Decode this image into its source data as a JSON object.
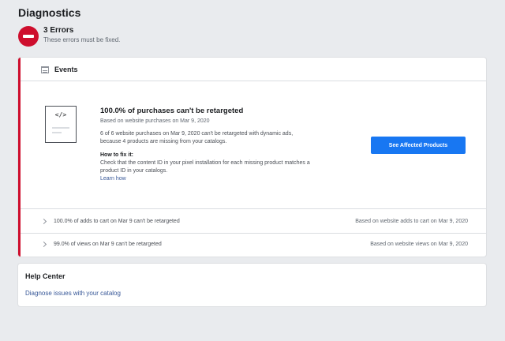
{
  "page": {
    "title": "Diagnostics"
  },
  "error_summary": {
    "count_label": "3 Errors",
    "subtitle": "These errors must be fixed.",
    "icon": "minus-circle-icon",
    "color": "#ce0e2d"
  },
  "events": {
    "title": "Events",
    "icon": "calendar-icon",
    "main_issue": {
      "thumb_glyph": "</>",
      "title": "100.0% of purchases can't be retargeted",
      "basis": "Based on website purchases on Mar 9, 2020",
      "description": "6 of 6 website purchases on Mar 9, 2020 can't be retargeted with dynamic ads, because 4 products are missing from your catalogs.",
      "fix_title": "How to fix it:",
      "fix_description": "Check that the content ID in your pixel installation for each missing product matches a product ID in your catalogs.",
      "learn_link": "Learn how",
      "button_label": "See Affected Products",
      "button_color": "#1877f2"
    },
    "rows": [
      {
        "label": "100.0% of adds to cart on Mar 9 can't be retargeted",
        "basis": "Based on website adds to cart on Mar 9, 2020"
      },
      {
        "label": "99.0% of views on Mar 9 can't be retargeted",
        "basis": "Based on website views on Mar 9, 2020"
      }
    ]
  },
  "help_center": {
    "title": "Help Center",
    "link": "Diagnose issues with your catalog"
  }
}
